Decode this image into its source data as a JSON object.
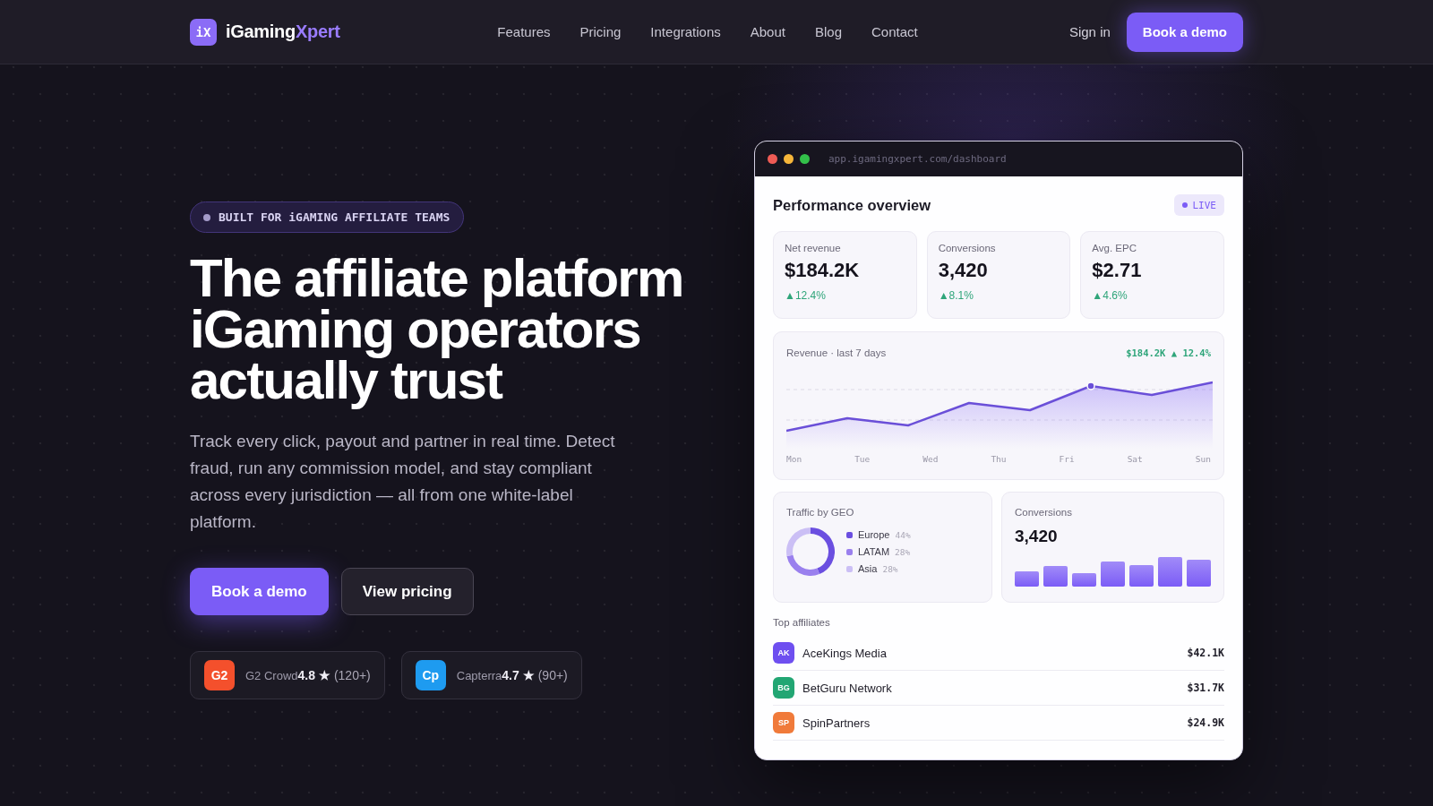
{
  "nav": {
    "logo": {
      "mark": "iX",
      "name": "iGaming",
      "accent": "Xpert"
    },
    "links": [
      "Features",
      "Pricing",
      "Integrations",
      "About",
      "Blog",
      "Contact"
    ],
    "sign_in": "Sign in",
    "cta": "Book a demo"
  },
  "hero": {
    "badge": "BUILT FOR iGAMING AFFILIATE TEAMS",
    "headline": "The affiliate platform iGaming operators actually trust",
    "description": "Track every click, payout and partner in real time. Detect fraud, run any commission model, and stay compliant across every jurisdiction — all from one white-label platform.",
    "buttons": [
      {
        "label": "Book a demo",
        "kind": "primary"
      },
      {
        "label": "View pricing",
        "kind": "secondary"
      }
    ],
    "ratings": [
      {
        "logo": "G2",
        "color": "#f4502c",
        "source": "G2 Crowd",
        "score": "4.8 ★",
        "count": "(120+)"
      },
      {
        "logo": "Cp",
        "color": "#1e9bf0",
        "source": "Capterra",
        "score": "4.7 ★",
        "count": "(90+)"
      }
    ]
  },
  "dashboard": {
    "url": "app.igamingxpert.com/dashboard",
    "title": "Performance overview",
    "live": "LIVE",
    "stats": [
      {
        "label": "Net revenue",
        "value": "$184.2K",
        "delta": "▲12.4%"
      },
      {
        "label": "Conversions",
        "value": "3,420",
        "delta": "▲8.1%"
      },
      {
        "label": "Avg. EPC",
        "value": "$2.71",
        "delta": "▲4.6%"
      }
    ],
    "revenue": {
      "title": "Revenue · last 7 days",
      "summary": "$184.2K ▲ 12.4%",
      "days": [
        "Mon",
        "Tue",
        "Wed",
        "Thu",
        "Fri",
        "Sat",
        "Sun"
      ]
    },
    "traffic": {
      "title": "Traffic by GEO",
      "chart_data": {
        "type": "donut",
        "categories": [
          "Europe",
          "LATAM",
          "Asia"
        ],
        "values": [
          44,
          28,
          28
        ],
        "value_labels": [
          "44%",
          "28%",
          "28%"
        ]
      },
      "legend": [
        {
          "color": "#6b4fe0"
        },
        {
          "color": "#9a80ee"
        },
        {
          "color": "#cbbff5"
        }
      ]
    },
    "conversions": {
      "title": "Conversions",
      "value": "3,420"
    },
    "affiliates": {
      "title": "Top affiliates",
      "rows": [
        {
          "initials": "AK",
          "name": "AceKings Media",
          "amount": "$42.1K",
          "color": "#6e4ff0"
        },
        {
          "initials": "BG",
          "name": "BetGuru Network",
          "amount": "$31.7K",
          "color": "#22a673"
        },
        {
          "initials": "SP",
          "name": "SpinPartners",
          "amount": "$24.9K",
          "color": "#f07a3a"
        }
      ]
    }
  }
}
